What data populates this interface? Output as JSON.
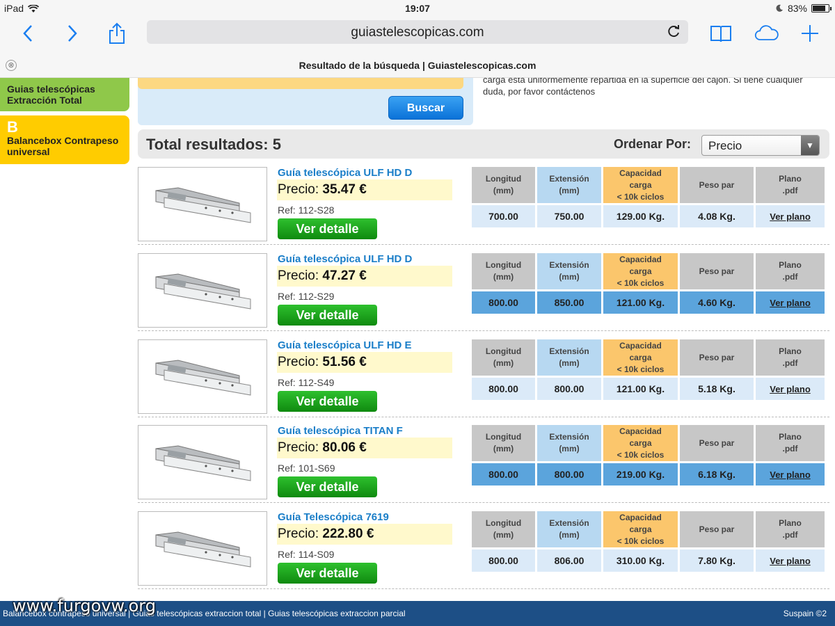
{
  "status_bar": {
    "device": "iPad",
    "time": "19:07",
    "battery": "83%",
    "battery_level": 0.83
  },
  "toolbar": {
    "url": "guiastelescopicas.com"
  },
  "tab": {
    "title": "Resultado de la búsqueda | Guiastelescopicas.com",
    "close_glyph": "⊗"
  },
  "sidebar": {
    "card1": {
      "label_line1": "Guias telescópicas",
      "label_line2": "Extracción Total"
    },
    "card2": {
      "letter": "B",
      "label_line1": "Balancebox Contrapeso",
      "label_line2": "universal"
    }
  },
  "search": {
    "button": "Buscar"
  },
  "info": {
    "line1": "carga está uniformemente repartida en la superficie del cajón. Si tiene cualquier",
    "line2": "duda, por favor contáctenos"
  },
  "results": {
    "total": "Total resultados: 5",
    "order_label": "Ordenar Por:",
    "order_value": "Precio",
    "arrow": "▼"
  },
  "table_headers": {
    "longitud": [
      "Longitud",
      "(mm)"
    ],
    "extension": [
      "Extensión",
      "(mm)"
    ],
    "capacidad": [
      "Capacidad",
      "carga",
      "< 10k ciclos"
    ],
    "peso": "Peso par",
    "plano": [
      "Plano",
      ".pdf"
    ]
  },
  "products": [
    {
      "name": "Guía telescópica ULF HD D",
      "price_label": "Precio:",
      "price": "35.47 €",
      "ref": "Ref: 112-S28",
      "button": "Ver detalle",
      "longitud": "700.00",
      "extension": "750.00",
      "capacidad": "129.00 Kg.",
      "peso": "4.08 Kg.",
      "plano": "Ver plano"
    },
    {
      "name": "Guía telescópica ULF HD D",
      "price_label": "Precio:",
      "price": "47.27 €",
      "ref": "Ref: 112-S29",
      "button": "Ver detalle",
      "longitud": "800.00",
      "extension": "850.00",
      "capacidad": "121.00 Kg.",
      "peso": "4.60 Kg.",
      "plano": "Ver plano"
    },
    {
      "name": "Guía telescópica ULF HD E",
      "price_label": "Precio:",
      "price": "51.56 €",
      "ref": "Ref: 112-S49",
      "button": "Ver detalle",
      "longitud": "800.00",
      "extension": "800.00",
      "capacidad": "121.00 Kg.",
      "peso": "5.18 Kg.",
      "plano": "Ver plano"
    },
    {
      "name": "Guía telescópica TITAN F",
      "price_label": "Precio:",
      "price": "80.06 €",
      "ref": "Ref: 101-S69",
      "button": "Ver detalle",
      "longitud": "800.00",
      "extension": "800.00",
      "capacidad": "219.00 Kg.",
      "peso": "6.18 Kg.",
      "plano": "Ver plano"
    },
    {
      "name": "Guía Telescópica 7619",
      "price_label": "Precio:",
      "price": "222.80 €",
      "ref": "Ref: 114-S09",
      "button": "Ver detalle",
      "longitud": "800.00",
      "extension": "806.00",
      "capacidad": "310.00 Kg.",
      "peso": "7.80 Kg.",
      "plano": "Ver plano"
    }
  ],
  "footer": {
    "links": "Balancebox contrapeso universal  |  Guias telescópicas extraccion total  |  Guias telescópicas extraccion parcial",
    "brand": "Suspain ©2"
  },
  "watermark": "www.furgovw.org"
}
